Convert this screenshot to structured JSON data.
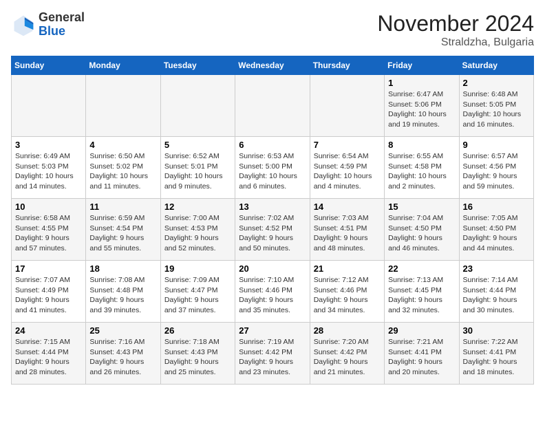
{
  "header": {
    "logo_line1": "General",
    "logo_line2": "Blue",
    "month": "November 2024",
    "location": "Straldzha, Bulgaria"
  },
  "weekdays": [
    "Sunday",
    "Monday",
    "Tuesday",
    "Wednesday",
    "Thursday",
    "Friday",
    "Saturday"
  ],
  "weeks": [
    [
      {
        "day": "",
        "info": ""
      },
      {
        "day": "",
        "info": ""
      },
      {
        "day": "",
        "info": ""
      },
      {
        "day": "",
        "info": ""
      },
      {
        "day": "",
        "info": ""
      },
      {
        "day": "1",
        "info": "Sunrise: 6:47 AM\nSunset: 5:06 PM\nDaylight: 10 hours and 19 minutes."
      },
      {
        "day": "2",
        "info": "Sunrise: 6:48 AM\nSunset: 5:05 PM\nDaylight: 10 hours and 16 minutes."
      }
    ],
    [
      {
        "day": "3",
        "info": "Sunrise: 6:49 AM\nSunset: 5:03 PM\nDaylight: 10 hours and 14 minutes."
      },
      {
        "day": "4",
        "info": "Sunrise: 6:50 AM\nSunset: 5:02 PM\nDaylight: 10 hours and 11 minutes."
      },
      {
        "day": "5",
        "info": "Sunrise: 6:52 AM\nSunset: 5:01 PM\nDaylight: 10 hours and 9 minutes."
      },
      {
        "day": "6",
        "info": "Sunrise: 6:53 AM\nSunset: 5:00 PM\nDaylight: 10 hours and 6 minutes."
      },
      {
        "day": "7",
        "info": "Sunrise: 6:54 AM\nSunset: 4:59 PM\nDaylight: 10 hours and 4 minutes."
      },
      {
        "day": "8",
        "info": "Sunrise: 6:55 AM\nSunset: 4:58 PM\nDaylight: 10 hours and 2 minutes."
      },
      {
        "day": "9",
        "info": "Sunrise: 6:57 AM\nSunset: 4:56 PM\nDaylight: 9 hours and 59 minutes."
      }
    ],
    [
      {
        "day": "10",
        "info": "Sunrise: 6:58 AM\nSunset: 4:55 PM\nDaylight: 9 hours and 57 minutes."
      },
      {
        "day": "11",
        "info": "Sunrise: 6:59 AM\nSunset: 4:54 PM\nDaylight: 9 hours and 55 minutes."
      },
      {
        "day": "12",
        "info": "Sunrise: 7:00 AM\nSunset: 4:53 PM\nDaylight: 9 hours and 52 minutes."
      },
      {
        "day": "13",
        "info": "Sunrise: 7:02 AM\nSunset: 4:52 PM\nDaylight: 9 hours and 50 minutes."
      },
      {
        "day": "14",
        "info": "Sunrise: 7:03 AM\nSunset: 4:51 PM\nDaylight: 9 hours and 48 minutes."
      },
      {
        "day": "15",
        "info": "Sunrise: 7:04 AM\nSunset: 4:50 PM\nDaylight: 9 hours and 46 minutes."
      },
      {
        "day": "16",
        "info": "Sunrise: 7:05 AM\nSunset: 4:50 PM\nDaylight: 9 hours and 44 minutes."
      }
    ],
    [
      {
        "day": "17",
        "info": "Sunrise: 7:07 AM\nSunset: 4:49 PM\nDaylight: 9 hours and 41 minutes."
      },
      {
        "day": "18",
        "info": "Sunrise: 7:08 AM\nSunset: 4:48 PM\nDaylight: 9 hours and 39 minutes."
      },
      {
        "day": "19",
        "info": "Sunrise: 7:09 AM\nSunset: 4:47 PM\nDaylight: 9 hours and 37 minutes."
      },
      {
        "day": "20",
        "info": "Sunrise: 7:10 AM\nSunset: 4:46 PM\nDaylight: 9 hours and 35 minutes."
      },
      {
        "day": "21",
        "info": "Sunrise: 7:12 AM\nSunset: 4:46 PM\nDaylight: 9 hours and 34 minutes."
      },
      {
        "day": "22",
        "info": "Sunrise: 7:13 AM\nSunset: 4:45 PM\nDaylight: 9 hours and 32 minutes."
      },
      {
        "day": "23",
        "info": "Sunrise: 7:14 AM\nSunset: 4:44 PM\nDaylight: 9 hours and 30 minutes."
      }
    ],
    [
      {
        "day": "24",
        "info": "Sunrise: 7:15 AM\nSunset: 4:44 PM\nDaylight: 9 hours and 28 minutes."
      },
      {
        "day": "25",
        "info": "Sunrise: 7:16 AM\nSunset: 4:43 PM\nDaylight: 9 hours and 26 minutes."
      },
      {
        "day": "26",
        "info": "Sunrise: 7:18 AM\nSunset: 4:43 PM\nDaylight: 9 hours and 25 minutes."
      },
      {
        "day": "27",
        "info": "Sunrise: 7:19 AM\nSunset: 4:42 PM\nDaylight: 9 hours and 23 minutes."
      },
      {
        "day": "28",
        "info": "Sunrise: 7:20 AM\nSunset: 4:42 PM\nDaylight: 9 hours and 21 minutes."
      },
      {
        "day": "29",
        "info": "Sunrise: 7:21 AM\nSunset: 4:41 PM\nDaylight: 9 hours and 20 minutes."
      },
      {
        "day": "30",
        "info": "Sunrise: 7:22 AM\nSunset: 4:41 PM\nDaylight: 9 hours and 18 minutes."
      }
    ]
  ]
}
